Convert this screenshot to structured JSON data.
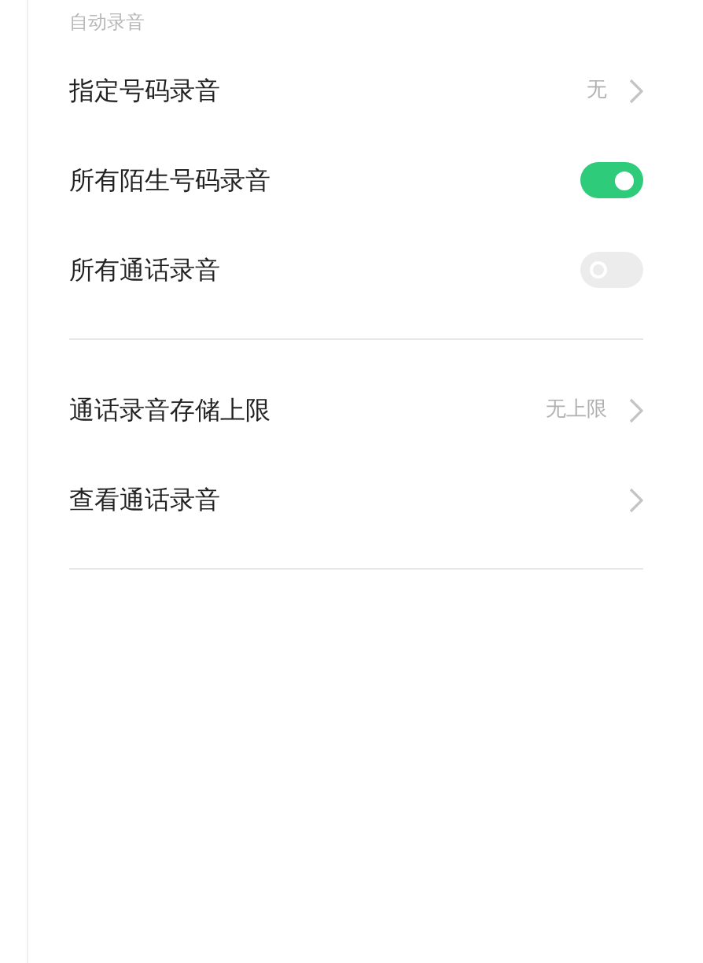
{
  "section": {
    "header": "自动录音"
  },
  "groups": [
    {
      "items": [
        {
          "kind": "value",
          "label": "指定号码录音",
          "value": "无"
        },
        {
          "kind": "toggle",
          "label": "所有陌生号码录音",
          "on": true
        },
        {
          "kind": "toggle",
          "label": "所有通话录音",
          "on": false
        }
      ]
    },
    {
      "items": [
        {
          "kind": "value",
          "label": "通话录音存储上限",
          "value": "无上限"
        },
        {
          "kind": "link",
          "label": "查看通话录音"
        }
      ]
    }
  ]
}
